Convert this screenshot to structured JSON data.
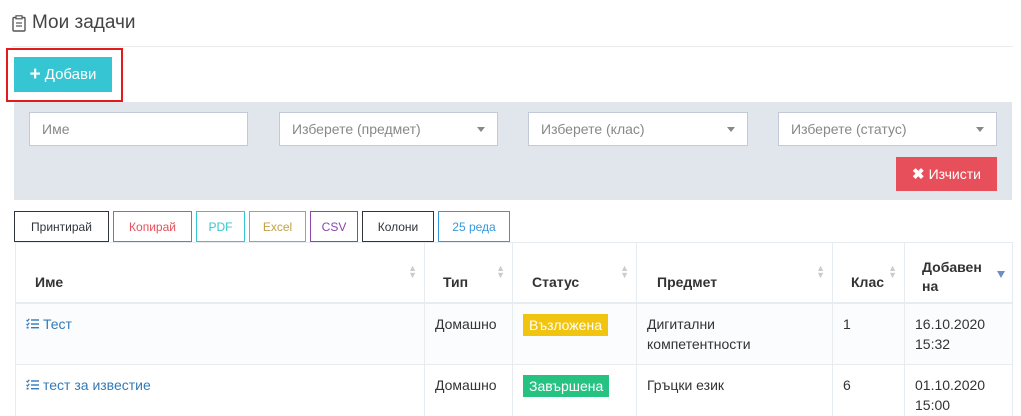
{
  "header": {
    "title": "Мои задачи",
    "icon": "clipboard-icon"
  },
  "toolbar": {
    "add_label": "Добави"
  },
  "filters": {
    "name_placeholder": "Име",
    "subject_placeholder": "Изберете (предмет)",
    "class_placeholder": "Изберете (клас)",
    "status_placeholder": "Изберете (статус)",
    "clear_label": "Изчисти"
  },
  "export_buttons": [
    {
      "label": "Принтирай",
      "color": "#2f353b"
    },
    {
      "label": "Копирай",
      "color": "#e7505a"
    },
    {
      "label": "PDF",
      "color": "#36c6d3"
    },
    {
      "label": "Excel",
      "color": "#c49f47"
    },
    {
      "label": "CSV",
      "color": "#8e44ad"
    },
    {
      "label": "Колони",
      "color": "#2f353b"
    },
    {
      "label": "25 реда",
      "color": "#3598dc"
    }
  ],
  "table": {
    "columns": [
      "Име",
      "Тип",
      "Статус",
      "Предмет",
      "Клас",
      "Добавен на"
    ],
    "rows": [
      {
        "name": "Тест",
        "type": "Домашно",
        "status": "Възложена",
        "subject": "Дигитални компетентности",
        "class": "1",
        "date": "16.10.2020",
        "time": "15:32"
      },
      {
        "name": "тест за известие",
        "type": "Домашно",
        "status": "Завършена",
        "subject": "Гръцки език",
        "class": "6",
        "date": "01.10.2020",
        "time": "15:00"
      }
    ]
  },
  "colors": {
    "primary": "#36c6d3",
    "danger": "#e7505a",
    "status_assigned": "#f1c40f",
    "status_done": "#26c281",
    "link": "#337ab7"
  }
}
